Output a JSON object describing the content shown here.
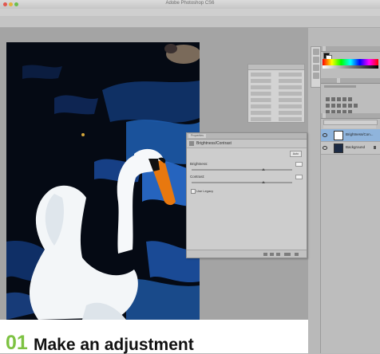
{
  "window": {
    "title": "Adobe Photoshop CS6"
  },
  "properties_panel": {
    "tab": "Properties",
    "title": "Brightness/Contrast",
    "auto_label": "Auto",
    "brightness_label": "Brightness:",
    "brightness_value": "0",
    "contrast_label": "Contrast:",
    "contrast_value": "0",
    "legacy_label": "Use Legacy"
  },
  "layers_panel": {
    "layers": [
      {
        "name": "Brightness/Con..."
      },
      {
        "name": "Background"
      }
    ]
  },
  "caption": {
    "step_number": "01",
    "heading": "Make an adjustment"
  },
  "colors": {
    "accent_green": "#7dc242"
  }
}
